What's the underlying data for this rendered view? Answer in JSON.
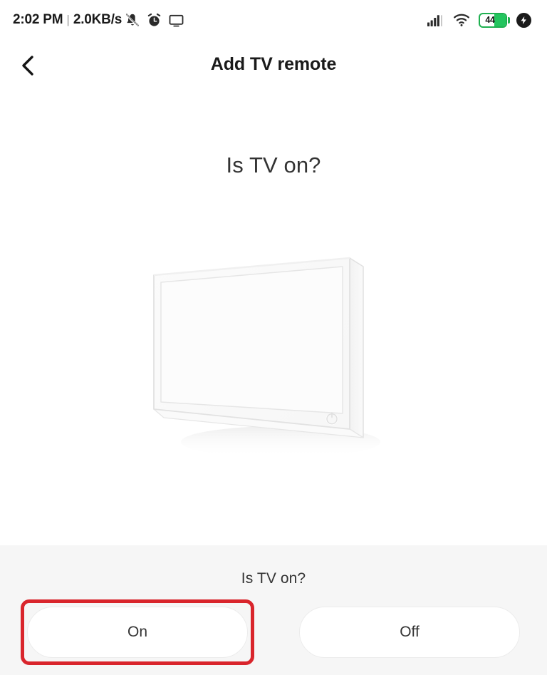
{
  "status_bar": {
    "time": "2:02 PM",
    "separator": "|",
    "network_speed": "2.0KB/s",
    "icons_left": [
      "mute-icon",
      "alarm-icon",
      "cast-icon"
    ],
    "icons_right": [
      "signal-icon",
      "wifi-icon",
      "battery-icon",
      "charging-icon"
    ],
    "battery_level": "44",
    "battery_color": "#23c55e"
  },
  "app_bar": {
    "back_icon": "chevron-left-icon",
    "title": "Add TV remote"
  },
  "main": {
    "heading": "Is TV on?",
    "illustration": "tv-screen-illustration",
    "illustration_power_icon": "power-icon"
  },
  "bottom": {
    "label": "Is TV on?",
    "buttons": [
      {
        "label": "On",
        "highlighted": true
      },
      {
        "label": "Off",
        "highlighted": false
      }
    ],
    "highlight_color": "#d9252c",
    "panel_color": "#f6f6f6"
  }
}
